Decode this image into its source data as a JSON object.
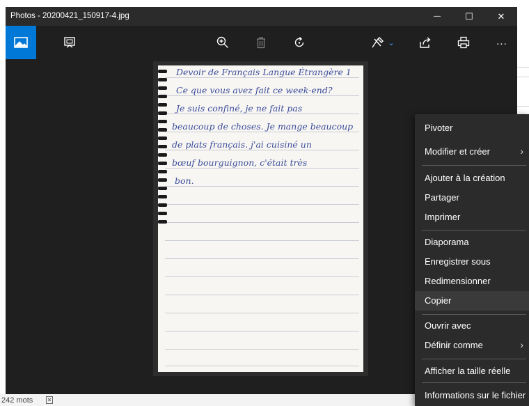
{
  "window": {
    "title": "Photos - 20200421_150917-4.jpg",
    "controls": {
      "minimize": "—",
      "maximize": "☐",
      "close": "✕"
    }
  },
  "toolbar": {
    "left": [
      {
        "icon": "image-icon",
        "active": true
      },
      {
        "icon": "slideshow-icon",
        "active": false
      }
    ],
    "right": [
      {
        "icon": "zoom-in-icon"
      },
      {
        "icon": "delete-icon",
        "disabled": true
      },
      {
        "icon": "rotate-icon"
      },
      {
        "icon": "edit-create-icon"
      },
      {
        "icon": "share-icon"
      },
      {
        "icon": "print-icon"
      },
      {
        "icon": "more-icon",
        "label": "..."
      }
    ]
  },
  "photo": {
    "handwriting": [
      "Devoir de Français Langue Étrangère 1",
      "Ce que vous avez fait ce week-end?",
      "Je suis confiné, je ne fait pas",
      "beaucoup de choses. Je mange beaucoup",
      "de plats français. j'ai cuisiné un",
      "bœuf bourguignon, c'était très",
      "bon."
    ]
  },
  "context_menu": {
    "items": [
      {
        "label": "Pivoter"
      },
      {
        "label": "Modifier et créer",
        "submenu": true
      },
      {
        "label": "Ajouter à la création"
      },
      {
        "label": "Partager"
      },
      {
        "label": "Imprimer"
      },
      {
        "label": "Diaporama"
      },
      {
        "label": "Enregistrer sous"
      },
      {
        "label": "Redimensionner"
      },
      {
        "label": "Copier",
        "highlighted": true
      },
      {
        "label": "Ouvrir avec"
      },
      {
        "label": "Définir comme",
        "submenu": true
      },
      {
        "label": "Afficher la taille réelle"
      },
      {
        "label": "Informations sur le fichier"
      }
    ],
    "submenu_glyph": "›"
  },
  "background_app": {
    "status_words": "242 mots",
    "status_icon": "document-icon"
  },
  "colors": {
    "accent": "#0078d7",
    "app_bg": "#1f1f1f",
    "menu_bg": "#2b2b2b",
    "ink": "#3c4d9c"
  }
}
